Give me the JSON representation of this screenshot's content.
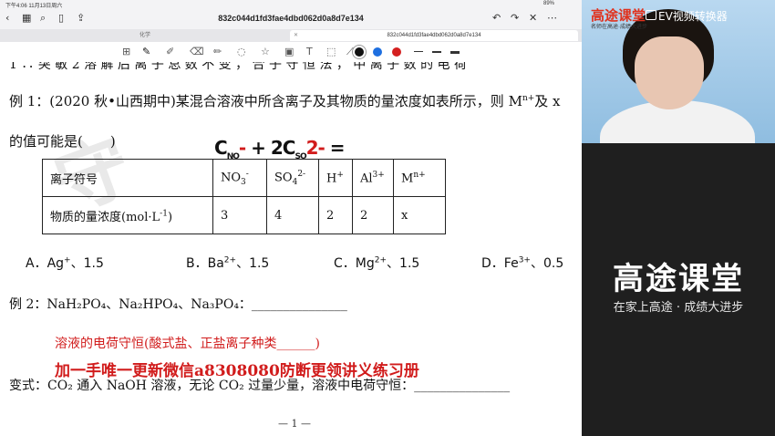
{
  "status": {
    "time": "下午4:06",
    "date": "11月13日周六",
    "battery": "89%"
  },
  "nav": {
    "doc_title": "832c044d1fd3fae4dbd062d0a8d7e134"
  },
  "tabs": [
    {
      "label": "化学"
    },
    {
      "label": "832c044d1fd3fae4dbd062d0a8d7e134"
    }
  ],
  "doc": {
    "cut_line": "1 ∴ 突 敏 2   溶 解 后 离 子 总 数 不 变 ，   合 子 守 恒 法 ，   中 离 子 数 的 电 荷",
    "q1_line1_a": "例 1：(2020 秋•山西期中)某混合溶液中所含离子及其物质的量浓度如表所示，则 M",
    "q1_line1_sup": "n+",
    "q1_line1_b": "及 x",
    "q1_line2": "的值可能是(　　)",
    "handwriting_a": "C",
    "handwriting_b": "NO",
    "handwriting_c": " + 2C",
    "handwriting_d": "SO",
    "handwriting_e": " =",
    "table": {
      "row1_label": "离子符号",
      "row2_label_a": "物质的量浓度(mol·L",
      "row2_label_sup": "-1",
      "row2_label_b": ")",
      "ions": [
        {
          "base": "NO",
          "sub": "3",
          "sup": "-"
        },
        {
          "base": "SO",
          "sub": "4",
          "sup": "2-"
        },
        {
          "base": "H",
          "sub": "",
          "sup": "+"
        },
        {
          "base": "Al",
          "sub": "",
          "sup": "3+"
        },
        {
          "base": "M",
          "sub": "",
          "sup": "n+"
        }
      ],
      "values": [
        "3",
        "4",
        "2",
        "2",
        "x"
      ]
    },
    "options": [
      {
        "letter": "A．Ag",
        "sup": "+",
        "rest": "、1.5"
      },
      {
        "letter": "B．Ba",
        "sup": "2+",
        "rest": "、1.5"
      },
      {
        "letter": "C．Mg",
        "sup": "2+",
        "rest": "、1.5"
      },
      {
        "letter": "D．Fe",
        "sup": "3+",
        "rest": "、0.5"
      }
    ],
    "q2": "例 2：NaH₂PO₄、Na₂HPO₄、Na₃PO₄：_______________",
    "red_note": "溶液的电荷守恒(酸式盐、正盐离子种类______)",
    "watermark": "加一手唯一更新微信a8308080防断更领讲义练习册",
    "variant": "变式：CO₂ 通入 NaOH 溶液，无论 CO₂ 过量少量，溶液中电荷守恒：_______________",
    "page_num": "— 1 —"
  },
  "right": {
    "brand_top": "高途课堂",
    "brand_sub": "名师在高途·成绩大进步",
    "ev_label": "EV视频转换器",
    "brand_big": "高途课堂",
    "slogan": "在家上高途 · 成绩大进步"
  },
  "colors": {
    "accent_red": "#d11c1c",
    "pen_blue": "#1e6fe0",
    "pen_red": "#d42020"
  },
  "icons": [
    "back-icon",
    "grid-icon",
    "search-icon",
    "bookmark-icon",
    "share-icon",
    "undo-icon",
    "redo-icon",
    "close-icon",
    "more-icon",
    "pen-icon",
    "eraser-icon",
    "highlighter-icon",
    "lasso-icon",
    "shape-icon",
    "image-icon",
    "text-icon",
    "ruler-icon"
  ]
}
